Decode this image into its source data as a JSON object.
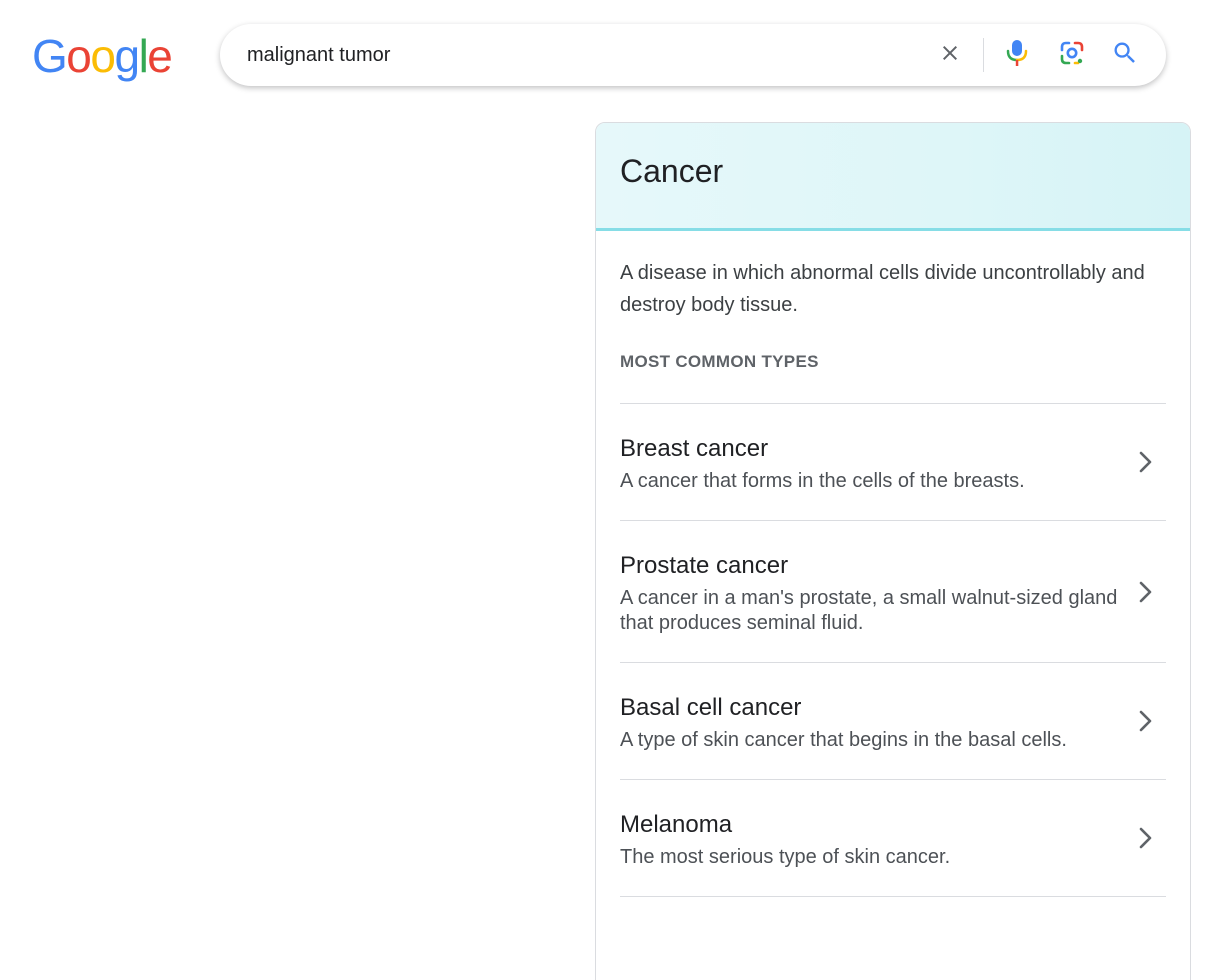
{
  "logo": {
    "letters": [
      "G",
      "o",
      "o",
      "g",
      "l",
      "e"
    ],
    "colors": [
      "#4285F4",
      "#EA4335",
      "#FBBC05",
      "#4285F4",
      "#34A853",
      "#EA4335"
    ]
  },
  "search": {
    "query": "malignant tumor",
    "clear_icon": "close-icon",
    "voice_icon": "microphone-icon",
    "lens_icon": "lens-camera-icon",
    "search_icon": "search-icon"
  },
  "panel": {
    "title": "Cancer",
    "description": "A disease in which abnormal cells divide uncontrollably and destroy body tissue.",
    "types_heading": "MOST COMMON TYPES",
    "types": [
      {
        "name": "Breast cancer",
        "description": "A cancer that forms in the cells of the breasts."
      },
      {
        "name": "Prostate cancer",
        "description": "A cancer in a man's prostate, a small walnut-sized gland that produces seminal fluid."
      },
      {
        "name": "Basal cell cancer",
        "description": "A type of skin cancer that begins in the basal cells."
      },
      {
        "name": "Melanoma",
        "description": "The most serious type of skin cancer."
      }
    ],
    "header_color": "#dff6f8",
    "header_accent": "#86dde6"
  }
}
